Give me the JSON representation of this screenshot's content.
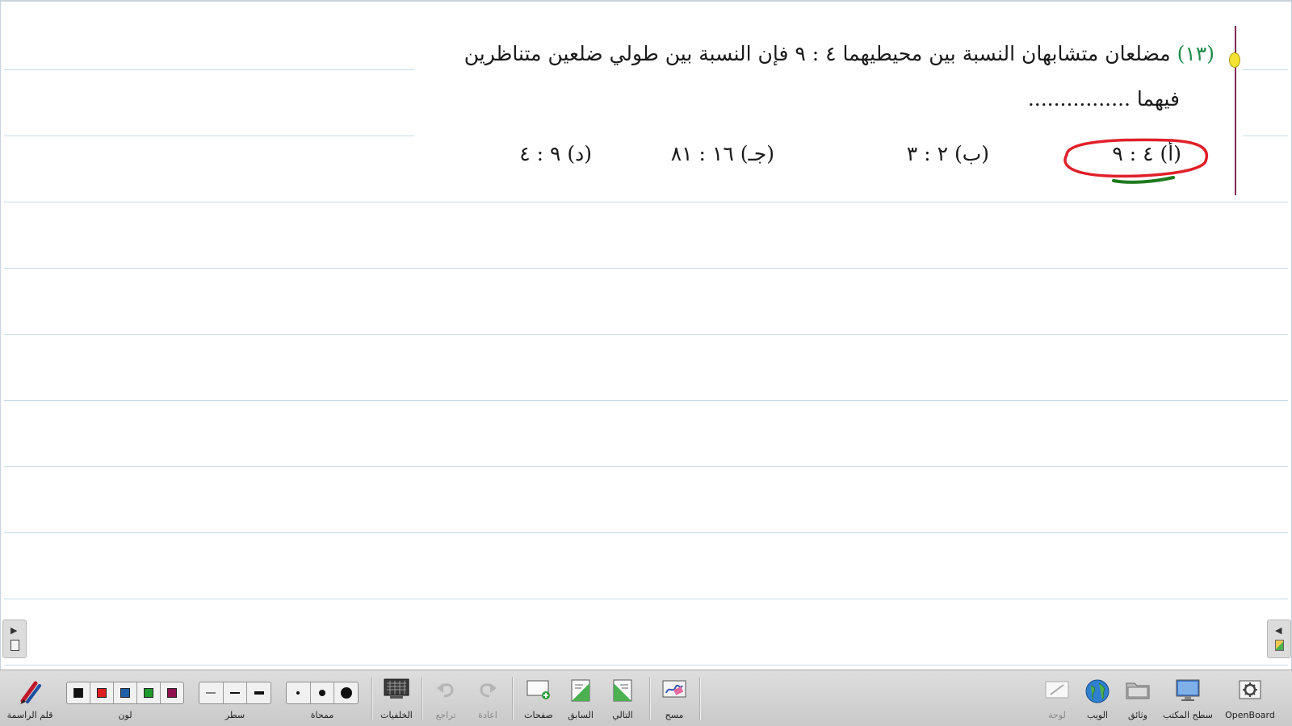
{
  "question": {
    "number": "(١٣)",
    "line1": "مضلعان متشابهان النسبة بين محيطيهما ٤ : ٩ فإن النسبة بين طولي ضلعين متناظرين",
    "line2": "فيهما ................"
  },
  "choices": [
    {
      "label": "(أ) ٤ : ٩",
      "circled": true
    },
    {
      "label": "(ب) ٢ : ٣",
      "circled": false
    },
    {
      "label": "(جـ) ١٦ : ٨١",
      "circled": false
    },
    {
      "label": "(د) ٩ : ٤",
      "circled": false
    }
  ],
  "annotation": {
    "circle_color": "#e0202a",
    "underline_color": "#1f7a1f"
  },
  "toolbar": {
    "pen": "قلم الراسمة",
    "color": "لون",
    "line": "سطر",
    "eraser": "ممحاة",
    "backgrounds": "الخلفيات",
    "undo": "تراجع",
    "redo": "اعادة",
    "pages": "صفحات",
    "previous": "السابق",
    "next": "التالي",
    "clear": "مسح",
    "board": "لوحة",
    "web": "الويب",
    "documents": "وثائق",
    "desktop": "سطح المكتب",
    "app": "OpenBoard"
  },
  "palette": [
    "#111111",
    "#e02020",
    "#1f5fa8",
    "#1f9a2e",
    "#8e1250"
  ],
  "accent": {
    "margin_rule": "#7b2a55",
    "question_number": "#1e8c4a"
  }
}
